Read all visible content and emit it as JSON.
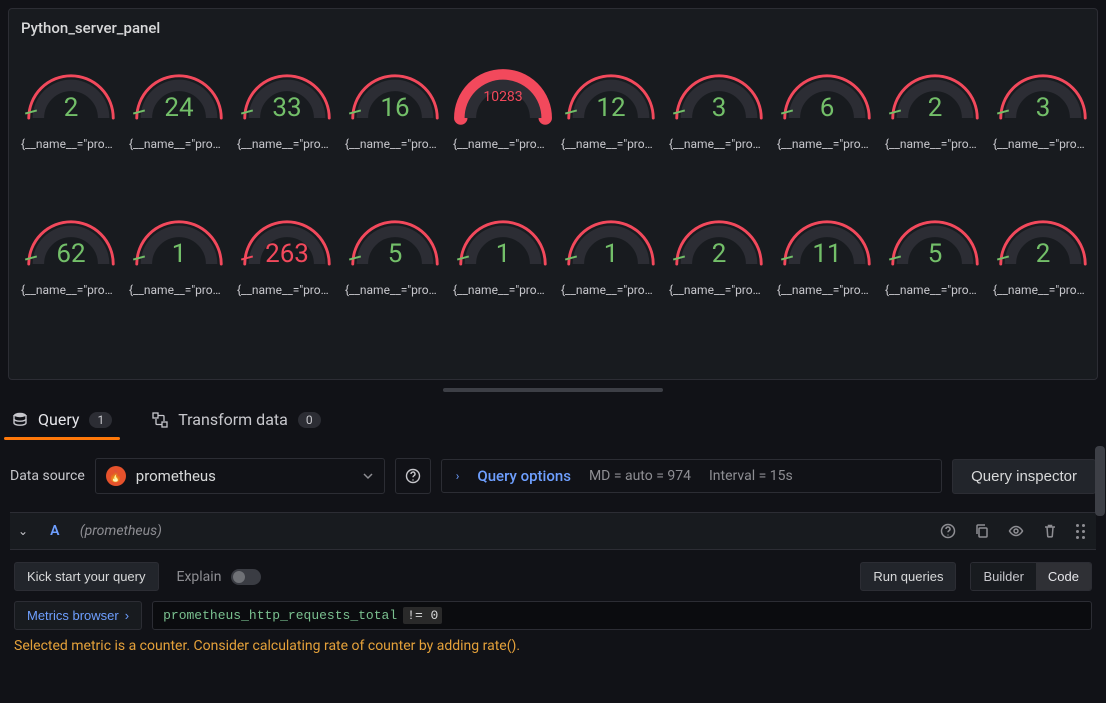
{
  "panel": {
    "title": "Python_server_panel",
    "label_template": "{__name__=\"prom…",
    "gauges": [
      {
        "value": "2",
        "status": "green"
      },
      {
        "value": "24",
        "status": "green"
      },
      {
        "value": "33",
        "status": "green"
      },
      {
        "value": "16",
        "status": "green"
      },
      {
        "value": "10283",
        "status": "red-full"
      },
      {
        "value": "12",
        "status": "green"
      },
      {
        "value": "3",
        "status": "green"
      },
      {
        "value": "6",
        "status": "green"
      },
      {
        "value": "2",
        "status": "green"
      },
      {
        "value": "3",
        "status": "green"
      },
      {
        "value": "62",
        "status": "green"
      },
      {
        "value": "1",
        "status": "green"
      },
      {
        "value": "263",
        "status": "red"
      },
      {
        "value": "5",
        "status": "green"
      },
      {
        "value": "1",
        "status": "green"
      },
      {
        "value": "1",
        "status": "green"
      },
      {
        "value": "2",
        "status": "green"
      },
      {
        "value": "11",
        "status": "green"
      },
      {
        "value": "5",
        "status": "green"
      },
      {
        "value": "2",
        "status": "green"
      }
    ]
  },
  "tabs": {
    "query_label": "Query",
    "query_count": "1",
    "transform_label": "Transform data",
    "transform_count": "0"
  },
  "query_bar": {
    "data_source_label": "Data source",
    "data_source_value": "prometheus",
    "options_label": "Query options",
    "md_text": "MD = auto = 974",
    "interval_text": "Interval = 15s",
    "inspector_label": "Query inspector"
  },
  "query_a": {
    "ref_id": "A",
    "source": "(prometheus)",
    "kick_start": "Kick start your query",
    "explain_label": "Explain",
    "run_label": "Run queries",
    "builder_label": "Builder",
    "code_label": "Code",
    "metrics_browser": "Metrics browser",
    "expr_metric": "prometheus_http_requests_total",
    "expr_op": "!= 0",
    "hint": "Selected metric is a counter. Consider calculating rate of counter by adding rate()."
  },
  "colors": {
    "green": "#73bf69",
    "red": "#f2495c",
    "orange": "#ff780a",
    "accent_blue": "#6e9fff"
  }
}
